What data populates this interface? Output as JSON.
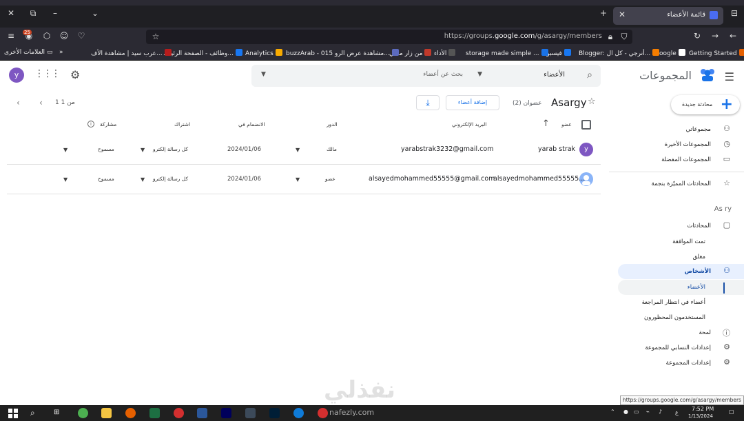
{
  "browser": {
    "tab_title": "قائمة الأعضاء",
    "url_prefix": "https://groups.",
    "url_domain": "google.com",
    "url_suffix": "/g/asargy/members",
    "notification_count": "25",
    "bookmarks": [
      {
        "label": "Getting Started",
        "color": "#e66000"
      },
      {
        "label": "Google",
        "color": "#ffffff"
      },
      {
        "label": "Blogger: أنرجي - كل ال...",
        "color": "#f57d00"
      },
      {
        "label": "فيسبوك",
        "color": "#1877f2"
      },
      {
        "label": "storage made simple ...",
        "color": "#1a73e8"
      },
      {
        "label": "الأداء",
        "color": "#555555"
      },
      {
        "label": "من زار ملفي",
        "color": "#c0392b"
      },
      {
        "label": "buzzArab - مشاهدة عرض الرو 015...",
        "color": "#5c6bc0"
      },
      {
        "label": "Analytics",
        "color": "#f9ab00"
      },
      {
        "label": "وظائف - الصفحة الرئيسـ...",
        "color": "#1877f2"
      },
      {
        "label": "عرب سيد | مشاهدة الأف...",
        "color": "#b71c1c"
      }
    ],
    "other_bookmarks": "العلامات الأخرى"
  },
  "header": {
    "app_name": "المجموعات",
    "search_scope": "الأعضاء",
    "search_placeholder": "بحث عن أعضاء",
    "avatar_letter": "y"
  },
  "nav": {
    "compose": "محادثة جديدة",
    "items": [
      {
        "label": "مجموعاتي"
      },
      {
        "label": "المجموعات الأخيرة"
      },
      {
        "label": "المجموعات المفضلة"
      },
      {
        "label": "المحادثات المميّزة بنجمة"
      }
    ],
    "group_head": "As ry",
    "group_items": [
      {
        "label": "المحادثات"
      },
      {
        "label": "تمت الموافقة"
      },
      {
        "label": "مغلق"
      },
      {
        "label": "الأشخاص"
      },
      {
        "label": "الأعضاء"
      },
      {
        "label": "أعضاء في انتظار المراجعة"
      },
      {
        "label": "المستخدمون المحظورون"
      },
      {
        "label": "لمحة"
      },
      {
        "label": "إعدادات النسابي للمجموعة"
      },
      {
        "label": "إعدادات المجموعة"
      }
    ]
  },
  "main": {
    "group_name": "Asargy",
    "member_count": "عضوان (2)",
    "add_members": "إضافة أعضاء",
    "pagination": "1 من 1",
    "columns": {
      "member": "عضو",
      "email": "البريد الإلكتروني",
      "role": "الدور",
      "joined": "الانضمام في",
      "subscription": "اشتراك",
      "posting": "مشاركة"
    },
    "rows": [
      {
        "avatar": "y",
        "avatar_color": "#7e57c2",
        "name": "yarab strak",
        "email": "yarabstrak3232@gmail.com",
        "role": "مالك",
        "joined": "2024/01/06",
        "subscription": "كل رسالة إلكترو",
        "posting": "مسموح"
      },
      {
        "avatar": "",
        "avatar_color": "#8ab4f8",
        "name": "alsayedmohammed55555...",
        "email": "alsayedmohammed55555@gmail.com",
        "role": "عضو",
        "joined": "2024/01/06",
        "subscription": "كل رسالة إلكترو",
        "posting": "مسموح"
      }
    ]
  },
  "status_tooltip": "https://groups.google.com/g/asargy/members",
  "watermark": "نفذلي",
  "watermark_sub": "nafezly.com",
  "taskbar": {
    "time": "7:52 PM",
    "date": "1/13/2024",
    "lang": "ع"
  }
}
